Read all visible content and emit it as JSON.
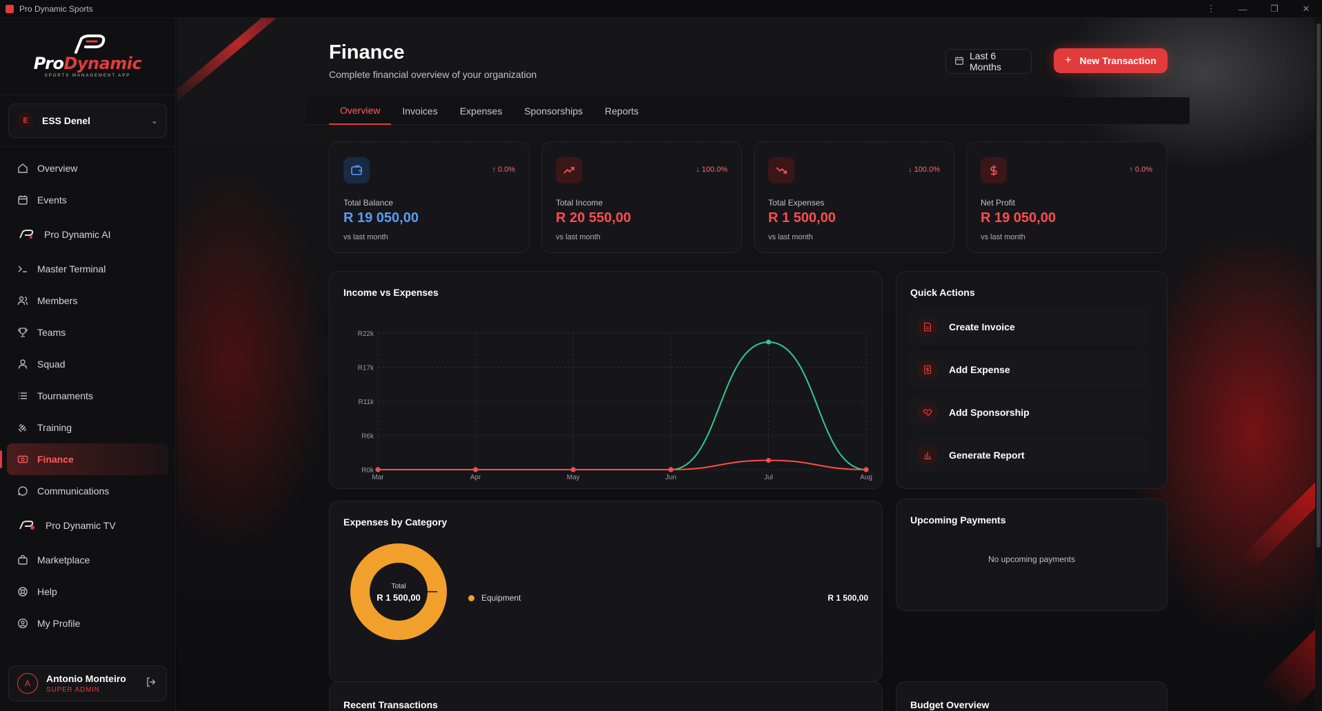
{
  "window": {
    "title": "Pro Dynamic Sports"
  },
  "brand": {
    "logo_pro": "Pro",
    "logo_dynamic": "Dynamic",
    "logo_sub": "SPORTS MANAGEMENT APP"
  },
  "org": {
    "initial": "E",
    "name": "ESS Denel"
  },
  "sidebar": {
    "items": [
      {
        "label": "Overview",
        "icon": "home-icon"
      },
      {
        "label": "Events",
        "icon": "calendar-icon"
      },
      {
        "label": "Pro Dynamic AI",
        "icon": "pd-logo-icon"
      },
      {
        "label": "Master Terminal",
        "icon": "terminal-icon"
      },
      {
        "label": "Members",
        "icon": "users-icon"
      },
      {
        "label": "Teams",
        "icon": "trophy-icon"
      },
      {
        "label": "Squad",
        "icon": "user-icon"
      },
      {
        "label": "Tournaments",
        "icon": "list-icon"
      },
      {
        "label": "Training",
        "icon": "dumbbell-icon"
      },
      {
        "label": "Finance",
        "icon": "wallet-icon"
      },
      {
        "label": "Communications",
        "icon": "chat-icon"
      },
      {
        "label": "Pro Dynamic TV",
        "icon": "tv-logo-icon"
      },
      {
        "label": "Marketplace",
        "icon": "bag-icon"
      },
      {
        "label": "Help",
        "icon": "lifebuoy-icon"
      },
      {
        "label": "My Profile",
        "icon": "profile-icon"
      }
    ],
    "active": "Finance"
  },
  "user": {
    "initial": "A",
    "name": "Antonio Monteiro",
    "role": "SUPER ADMIN"
  },
  "header": {
    "title": "Finance",
    "subtitle": "Complete financial overview of your organization",
    "range_label": "Last 6 Months",
    "new_button": "New Transaction"
  },
  "tabs": [
    "Overview",
    "Invoices",
    "Expenses",
    "Sponsorships",
    "Reports"
  ],
  "stats": [
    {
      "label": "Total Balance",
      "value": "R 19 050,00",
      "change": "↑ 0.0%",
      "compare": "vs last month",
      "value_color": "#5b9cf5",
      "icon": "wallet-icon"
    },
    {
      "label": "Total Income",
      "value": "R 20 550,00",
      "change": "↓ 100.0%",
      "compare": "vs last month",
      "value_color": "#ff4d4d",
      "icon": "trending-up-icon"
    },
    {
      "label": "Total Expenses",
      "value": "R 1 500,00",
      "change": "↓ 100.0%",
      "compare": "vs last month",
      "value_color": "#ff4d4d",
      "icon": "trending-down-icon"
    },
    {
      "label": "Net Profit",
      "value": "R 19 050,00",
      "change": "↑ 0.0%",
      "compare": "vs last month",
      "value_color": "#ff4d4d",
      "icon": "dollar-icon"
    }
  ],
  "income_chart": {
    "title": "Income vs Expenses"
  },
  "chart_data": {
    "type": "line",
    "title": "Income vs Expenses",
    "categories": [
      "Mar",
      "Apr",
      "May",
      "Jun",
      "Jul",
      "Aug"
    ],
    "y_ticks": [
      "R0k",
      "R6k",
      "R11k",
      "R17k",
      "R22k"
    ],
    "ylim": [
      0,
      22000
    ],
    "series": [
      {
        "color": "#33c98f",
        "values": [
          0,
          0,
          0,
          0,
          20550,
          0
        ]
      },
      {
        "color": "#ff4d4d",
        "values": [
          0,
          0,
          0,
          0,
          1500,
          0
        ]
      }
    ],
    "grid": true
  },
  "quick_actions": {
    "title": "Quick Actions",
    "items": [
      {
        "label": "Create Invoice",
        "icon": "document-icon"
      },
      {
        "label": "Add Expense",
        "icon": "receipt-icon"
      },
      {
        "label": "Add Sponsorship",
        "icon": "handshake-icon"
      },
      {
        "label": "Generate Report",
        "icon": "bar-chart-icon"
      }
    ]
  },
  "expenses_by_category": {
    "title": "Expenses by Category",
    "center_label": "Total",
    "center_value": "R 1 500,00",
    "categories": [
      {
        "name": "Equipment",
        "amount": "R 1 500,00",
        "color": "#f2a02c",
        "share": 1.0
      }
    ]
  },
  "upcoming_payments": {
    "title": "Upcoming Payments",
    "empty": "No upcoming payments"
  },
  "recent_transactions": {
    "title": "Recent Transactions"
  },
  "budget_overview": {
    "title": "Budget Overview"
  }
}
